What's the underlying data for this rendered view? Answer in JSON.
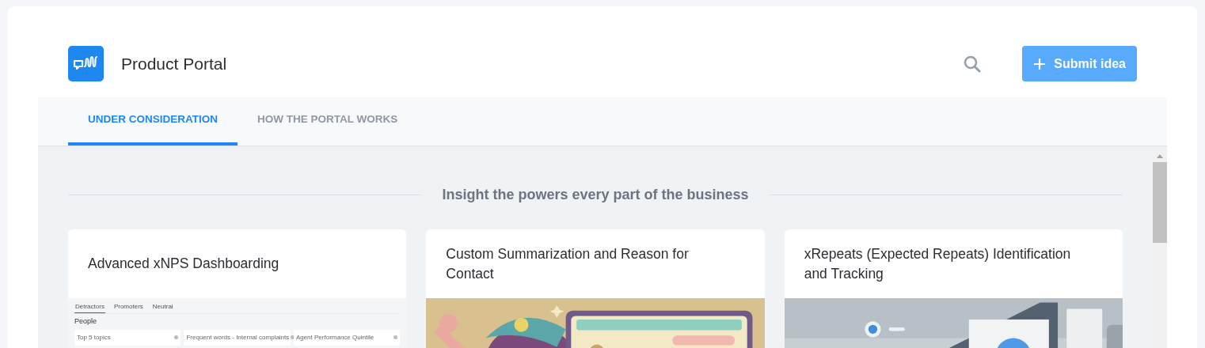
{
  "header": {
    "title": "Product Portal",
    "submit_button": "Submit idea"
  },
  "tabs": [
    {
      "label": "UNDER CONSIDERATION",
      "selected": true
    },
    {
      "label": "HOW THE PORTAL WORKS",
      "selected": false
    }
  ],
  "section": {
    "heading": "Insight the powers every part of the business"
  },
  "cards": [
    {
      "title": "Advanced xNPS Dashboarding",
      "image": {
        "kind": "screenshot",
        "tabs": [
          {
            "label": "Detractors",
            "selected": true
          },
          {
            "label": "Promoters",
            "selected": false
          },
          {
            "label": "Neutral",
            "selected": false
          }
        ],
        "heading": "People",
        "widgets": [
          "Top 5 topics",
          "Frequent words - Internal complaints",
          "Agent Performance Quintile"
        ]
      }
    },
    {
      "title": "Custom Summarization and Reason for Contact"
    },
    {
      "title": "xRepeats (Expected Repeats) Identification and Tracking"
    }
  ]
}
